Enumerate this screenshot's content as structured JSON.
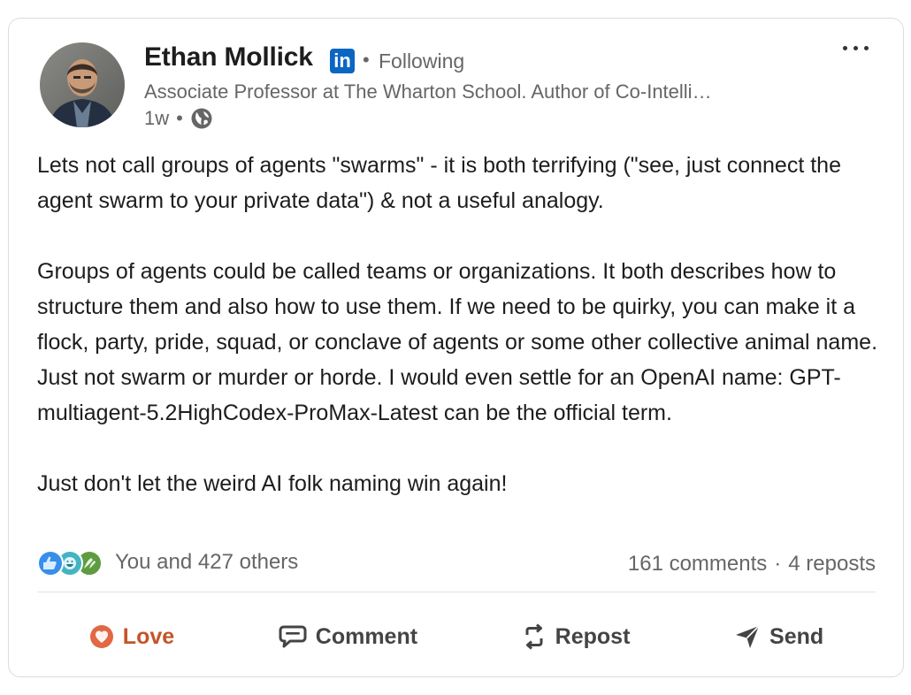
{
  "post": {
    "author": {
      "name": "Ethan Mollick",
      "badge": "in",
      "follow_status": "Following",
      "headline": "Associate Professor at The Wharton School. Author of Co-Intelli…",
      "time": "1w",
      "visibility_icon": "globe-icon"
    },
    "body": [
      "Lets not call groups of agents \"swarms\" - it is both terrifying (\"see, just connect the agent swarm to your private data\") & not a useful analogy.",
      "Groups of agents could be called teams or organizations. It both describes how to structure them and also how to use them. If we need to be quirky, you can make it a flock, party, pride, squad, or conclave of agents or some other collective animal name. Just not swarm or murder or horde. I would even settle for an OpenAI name: GPT-multiagent-5.2HighCodex-ProMax-Latest can be the official term.",
      "Just don't let the weird AI folk naming win again!"
    ],
    "reactions": {
      "icons": [
        "like-icon",
        "funny-icon",
        "celebrate-icon"
      ],
      "summary": "You and 427 others"
    },
    "engagement": {
      "comments": "161 comments",
      "separator": "·",
      "reposts": "4 reposts"
    },
    "actions": {
      "love": "Love",
      "comment": "Comment",
      "repost": "Repost",
      "send": "Send"
    }
  },
  "colors": {
    "linkedin_blue": "#0a66c2",
    "love": "#c4542a",
    "muted_text": "#666666"
  }
}
